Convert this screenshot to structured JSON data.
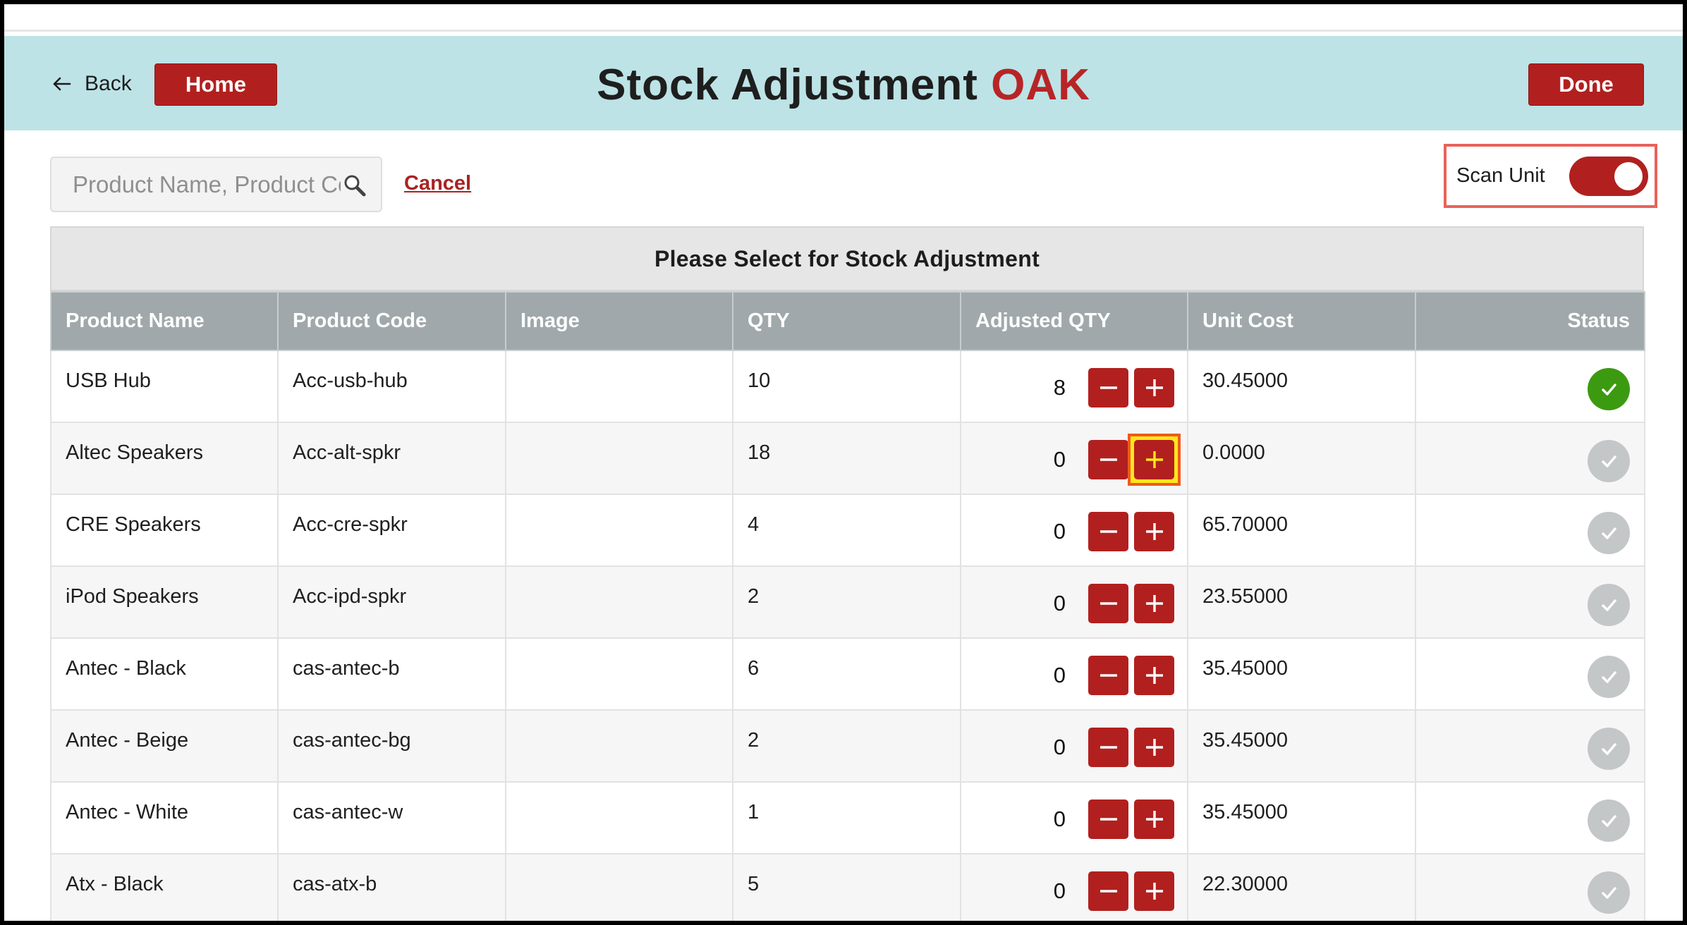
{
  "header": {
    "back_label": "Back",
    "home_label": "Home",
    "title": "Stock Adjustment",
    "title_accent": "OAK",
    "done_label": "Done",
    "background_color": "#bde3e6",
    "accent_color": "#b1201f"
  },
  "search": {
    "placeholder": "Product Name, Product Code",
    "value": "",
    "cancel_label": "Cancel"
  },
  "scan_unit": {
    "label": "Scan Unit",
    "enabled": true
  },
  "table": {
    "caption": "Please Select for Stock Adjustment",
    "columns": [
      "Product Name",
      "Product Code",
      "Image",
      "QTY",
      "Adjusted QTY",
      "Unit Cost",
      "Status"
    ],
    "rows": [
      {
        "name": "USB Hub",
        "code": "Acc-usb-hub",
        "qty": "10",
        "adjusted": "8",
        "unit_cost": "30.45000",
        "status": "selected"
      },
      {
        "name": "Altec Speakers",
        "code": "Acc-alt-spkr",
        "qty": "18",
        "adjusted": "0",
        "unit_cost": "0.0000",
        "status": "unselected"
      },
      {
        "name": "CRE Speakers",
        "code": "Acc-cre-spkr",
        "qty": "4",
        "adjusted": "0",
        "unit_cost": "65.70000",
        "status": "unselected"
      },
      {
        "name": "iPod Speakers",
        "code": "Acc-ipd-spkr",
        "qty": "2",
        "adjusted": "0",
        "unit_cost": "23.55000",
        "status": "unselected"
      },
      {
        "name": "Antec - Black",
        "code": "cas-antec-b",
        "qty": "6",
        "adjusted": "0",
        "unit_cost": "35.45000",
        "status": "unselected"
      },
      {
        "name": "Antec - Beige",
        "code": "cas-antec-bg",
        "qty": "2",
        "adjusted": "0",
        "unit_cost": "35.45000",
        "status": "unselected"
      },
      {
        "name": "Antec - White",
        "code": "cas-antec-w",
        "qty": "1",
        "adjusted": "0",
        "unit_cost": "35.45000",
        "status": "unselected"
      },
      {
        "name": "Atx - Black",
        "code": "cas-atx-b",
        "qty": "5",
        "adjusted": "0",
        "unit_cost": "22.30000",
        "status": "unselected"
      }
    ]
  },
  "icons": {
    "back": "arrow-left-icon",
    "search": "search-icon",
    "decrement": "minus-icon",
    "increment": "plus-icon",
    "status": "check-circle-icon"
  },
  "status_colors": {
    "selected": "#3c9a11",
    "unselected": "#c3c7c8"
  }
}
